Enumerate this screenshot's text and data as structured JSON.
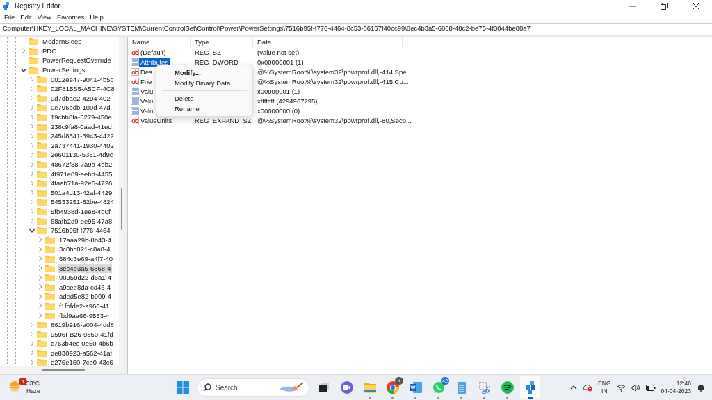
{
  "window": {
    "title": "Registry Editor"
  },
  "menu": [
    "File",
    "Edit",
    "View",
    "Favorites",
    "Help"
  ],
  "address": "Computer\\HKEY_LOCAL_MACHINE\\SYSTEM\\CurrentControlSet\\Control\\Power\\PowerSettings\\7516b95f-f776-4464-8c53-06167f40cc99\\8ec4b3a5-6868-48c2-be75-4f3044be88a7",
  "tree": [
    {
      "label": "ModernSleep",
      "expandable": false,
      "selected": false
    },
    {
      "label": "PDC",
      "expandable": true,
      "expanded": false,
      "selected": false
    },
    {
      "label": "PowerRequestOverride",
      "expandable": false,
      "selected": false
    },
    {
      "label": "PowerSettings",
      "expandable": true,
      "expanded": true,
      "selected": false,
      "children": [
        {
          "label": "0012ee47-9041-4b5c",
          "expandable": true,
          "expanded": false,
          "selected": false
        },
        {
          "label": "02F815B5-A5CF-4C8",
          "expandable": true,
          "expanded": false,
          "selected": false
        },
        {
          "label": "0d7dbae2-4294-402",
          "expandable": true,
          "expanded": false,
          "selected": false
        },
        {
          "label": "0e796bdb-100d-47d",
          "expandable": true,
          "expanded": false,
          "selected": false
        },
        {
          "label": "19cbb8fa-5279-450e",
          "expandable": true,
          "expanded": false,
          "selected": false
        },
        {
          "label": "238c9fa8-0aad-41ed",
          "expandable": true,
          "expanded": false,
          "selected": false
        },
        {
          "label": "245d8541-3943-4422",
          "expandable": true,
          "expanded": false,
          "selected": false
        },
        {
          "label": "2a737441-1930-4402",
          "expandable": true,
          "expanded": false,
          "selected": false
        },
        {
          "label": "2e601130-5351-4d9c",
          "expandable": true,
          "expanded": false,
          "selected": false
        },
        {
          "label": "48672f38-7a9a-4bb2",
          "expandable": true,
          "expanded": false,
          "selected": false
        },
        {
          "label": "4f971e89-eebd-4455",
          "expandable": true,
          "expanded": false,
          "selected": false
        },
        {
          "label": "4faab71a-92e5-4726",
          "expandable": true,
          "expanded": false,
          "selected": false
        },
        {
          "label": "501a4d13-42af-4429",
          "expandable": true,
          "expanded": false,
          "selected": false
        },
        {
          "label": "54533251-82be-4824",
          "expandable": true,
          "expanded": false,
          "selected": false
        },
        {
          "label": "5fb4938d-1ee8-4b0f",
          "expandable": true,
          "expanded": false,
          "selected": false
        },
        {
          "label": "68afb2d9-ee95-47a8",
          "expandable": true,
          "expanded": false,
          "selected": false
        },
        {
          "label": "7516b95f-f776-4464-",
          "expandable": true,
          "expanded": true,
          "selected": false,
          "children": [
            {
              "label": "17aaa29b-8b43-4",
              "expandable": true,
              "expanded": false,
              "selected": false
            },
            {
              "label": "3c0bc021-c8a8-4",
              "expandable": true,
              "expanded": false,
              "selected": false
            },
            {
              "label": "684c3e69-a4f7-40",
              "expandable": true,
              "expanded": false,
              "selected": false
            },
            {
              "label": "8ec4b3a5-6868-4",
              "expandable": true,
              "expanded": false,
              "selected": true
            },
            {
              "label": "90959d22-d6a1-4",
              "expandable": true,
              "expanded": false,
              "selected": false
            },
            {
              "label": "a9ceb8da-cd46-4",
              "expandable": true,
              "expanded": false,
              "selected": false
            },
            {
              "label": "aded5e82-b909-4",
              "expandable": true,
              "expanded": false,
              "selected": false
            },
            {
              "label": "f1fbfde2-a960-41",
              "expandable": true,
              "expanded": false,
              "selected": false
            },
            {
              "label": "fbd9aa66-9553-4",
              "expandable": true,
              "expanded": false,
              "selected": false
            }
          ]
        },
        {
          "label": "8619b916-e004-4dd8",
          "expandable": true,
          "expanded": false,
          "selected": false
        },
        {
          "label": "9596FB26-9850-41fd",
          "expandable": true,
          "expanded": false,
          "selected": false
        },
        {
          "label": "c763b4ec-0e50-4b6b",
          "expandable": true,
          "expanded": false,
          "selected": false
        },
        {
          "label": "de830923-a562-41af",
          "expandable": true,
          "expanded": false,
          "selected": false
        },
        {
          "label": "e276e160-7cb0-43c6",
          "expandable": true,
          "expanded": false,
          "selected": false
        }
      ]
    }
  ],
  "values": {
    "columns": [
      "Name",
      "Type",
      "Data"
    ],
    "rows": [
      {
        "kind": "string",
        "name": "(Default)",
        "type": "REG_SZ",
        "data": "(value not set)",
        "selected": false
      },
      {
        "kind": "binary",
        "name": "Attributes",
        "type": "REG_DWORD",
        "data": "0x00000001 (1)",
        "selected": true
      },
      {
        "kind": "string",
        "name": "Des",
        "data": "@%SystemRoot%\\system32\\powrprof.dll,-414,Spe...",
        "selected": false
      },
      {
        "kind": "string",
        "name": "Frie",
        "data": "@%SystemRoot%\\system32\\powrprof.dll,-415,Co...",
        "selected": false
      },
      {
        "kind": "binary",
        "name": "Valu",
        "data": "x00000001 (1)",
        "selected": false
      },
      {
        "kind": "binary",
        "name": "Valu",
        "data": "xffffffff (4294967295)",
        "selected": false
      },
      {
        "kind": "binary",
        "name": "Valu",
        "data": "x00000000 (0)",
        "selected": false
      },
      {
        "kind": "string",
        "name": "ValueUnits",
        "type": "REG_EXPAND_SZ",
        "data": "@%SystemRoot%\\system32\\powrprof.dll,-80,Seco...",
        "selected": false
      }
    ]
  },
  "context_menu": [
    {
      "kind": "item",
      "label": "Modify...",
      "default": true
    },
    {
      "kind": "item",
      "label": "Modify Binary Data...",
      "default": false
    },
    {
      "kind": "separator"
    },
    {
      "kind": "item",
      "label": "Delete",
      "default": false
    },
    {
      "kind": "item",
      "label": "Rename",
      "default": false
    }
  ],
  "taskbar": {
    "weather": {
      "badge": "1",
      "temperature": "33°C",
      "condition": "Haze"
    },
    "search": {
      "placeholder": "Search"
    },
    "apps": [
      {
        "kind": "taskview",
        "running": false,
        "active": false
      },
      {
        "kind": "meet",
        "running": false,
        "active": false
      },
      {
        "kind": "explorer",
        "running": true,
        "active": false
      },
      {
        "kind": "browser",
        "badge": "K",
        "running": true,
        "active": false
      },
      {
        "kind": "word",
        "running": true,
        "active": false
      },
      {
        "kind": "chat",
        "badge": "42",
        "running": true,
        "active": false
      },
      {
        "kind": "notepad",
        "running": true,
        "active": false
      },
      {
        "kind": "snip",
        "running": true,
        "active": false
      },
      {
        "kind": "music",
        "running": true,
        "active": false
      },
      {
        "kind": "registry",
        "running": true,
        "active": true
      }
    ],
    "language": [
      "ENG",
      "IN"
    ],
    "time": "12:46",
    "date": "04-04-2023"
  }
}
